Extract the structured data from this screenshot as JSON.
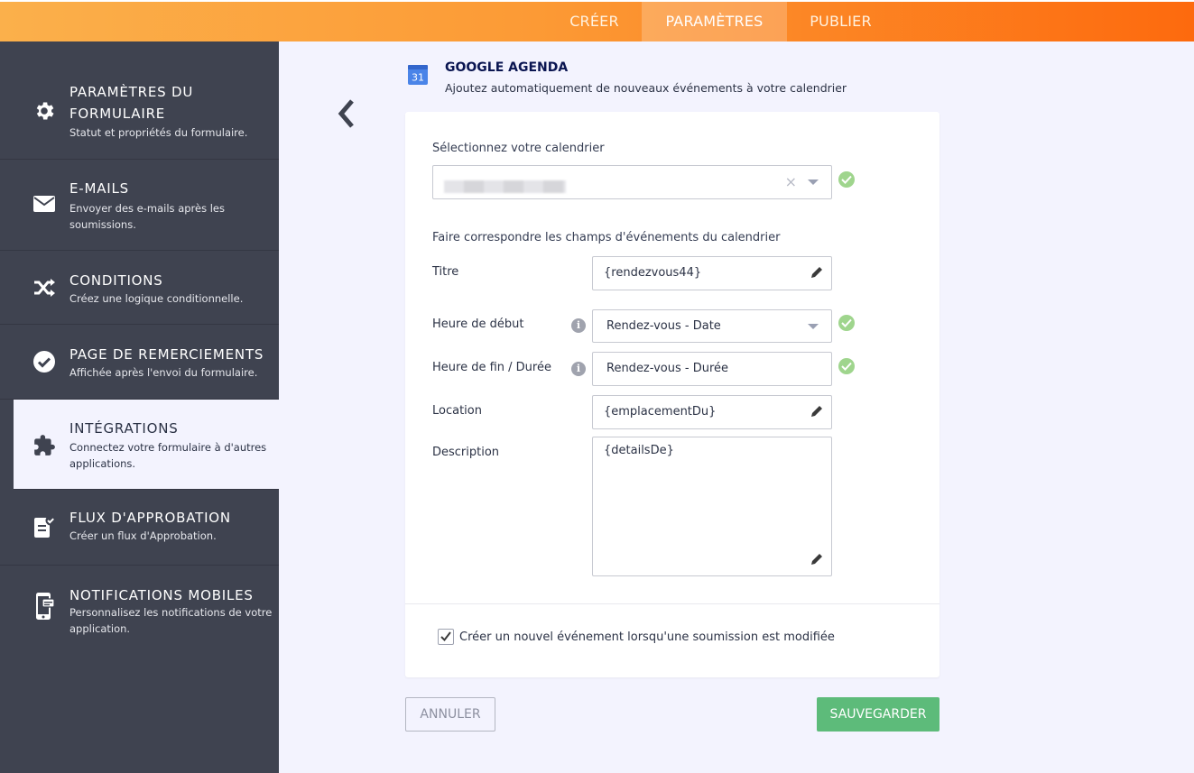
{
  "topbar": {
    "tabs": [
      {
        "label": "CRÉER"
      },
      {
        "label": "PARAMÈTRES"
      },
      {
        "label": "PUBLIER"
      }
    ]
  },
  "sidebar": {
    "items": [
      {
        "title": "PARAMÈTRES DU FORMULAIRE",
        "subtitle": "Statut et propriétés du formulaire.",
        "icon": "gear-icon"
      },
      {
        "title": "E-MAILS",
        "subtitle": "Envoyer des e-mails après les soumissions.",
        "icon": "envelope-icon"
      },
      {
        "title": "CONDITIONS",
        "subtitle": "Créez une logique conditionnelle.",
        "icon": "shuffle-icon"
      },
      {
        "title": "PAGE DE REMERCIEMENTS",
        "subtitle": "Affichée après l'envoi du formulaire.",
        "icon": "check-circle-icon"
      },
      {
        "title": "INTÉGRATIONS",
        "subtitle": "Connectez votre formulaire à d'autres applications.",
        "icon": "puzzle-icon"
      },
      {
        "title": "FLUX D'APPROBATION",
        "subtitle": "Créer un flux d'Approbation.",
        "icon": "approval-icon"
      },
      {
        "title": "NOTIFICATIONS MOBILES",
        "subtitle": "Personnalisez les notifications de votre application.",
        "icon": "mobile-icon"
      }
    ]
  },
  "header": {
    "icon_text": "31",
    "title": "GOOGLE AGENDA",
    "subtitle": "Ajoutez automatiquement de nouveaux événements à votre calendrier"
  },
  "form": {
    "calendar_label": "Sélectionnez votre calendrier",
    "mapping_label": "Faire correspondre les champs d'événements du calendrier",
    "fields": {
      "title": {
        "label": "Titre",
        "value": "{rendezvous44}"
      },
      "start": {
        "label": "Heure de début",
        "value": "Rendez-vous - Date"
      },
      "end": {
        "label": "Heure de fin / Durée",
        "value": "Rendez-vous - Durée"
      },
      "location": {
        "label": "Location",
        "value": "{emplacementDu}"
      },
      "description": {
        "label": "Description",
        "value": "{detailsDe}"
      }
    },
    "clear_glyph": "×",
    "info_glyph": "i",
    "checkbox_label": "Créer un nouvel événement lorsqu'une soumission est modifiée",
    "checkbox_checked": true
  },
  "buttons": {
    "cancel": "ANNULER",
    "save": "SAUVEGARDER"
  },
  "colors": {
    "accent_orange": "#fd8a23",
    "sidebar_bg": "#3f4350",
    "success_green": "#9fd58d",
    "save_green": "#5dbb7a"
  }
}
